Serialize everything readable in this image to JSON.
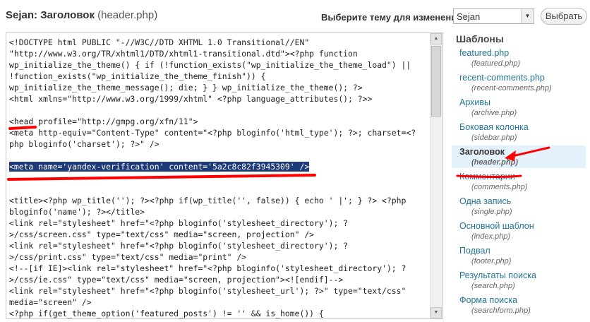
{
  "header": {
    "theme_name": "Sejan:",
    "file_title": "Заголовок",
    "file_name": "(header.php)"
  },
  "theme_picker": {
    "label": "Выберите тему для изменения:",
    "selected": "Sejan",
    "button": "Выбрать"
  },
  "editor": {
    "lines": [
      "<!DOCTYPE html PUBLIC \"-//W3C//DTD XHTML 1.0 Transitional//EN\"",
      "\"http://www.w3.org/TR/xhtml1/DTD/xhtml1-transitional.dtd\"><?php function",
      "wp_initialize_the_theme() { if (!function_exists(\"wp_initialize_the_theme_load\") ||",
      "!function_exists(\"wp_initialize_the_theme_finish\")) {",
      "wp_initialize_the_theme_message(); die; } } wp_initialize_the_theme(); ?>",
      "<html xmlns=\"http://www.w3.org/1999/xhtml\" <?php language_attributes(); ?>>",
      "",
      "<head profile=\"http://gmpg.org/xfn/11\">",
      "<meta http-equiv=\"Content-Type\" content=\"<?php bloginfo('html_type'); ?>; charset=<?",
      "php bloginfo('charset'); ?>\" />",
      "",
      "<meta name='yandex-verification' content='5a2c8c82f3945309' />",
      "",
      "",
      "<title><?php wp_title(''); ?><?php if(wp_title('', false)) { echo ' |'; } ?> <?php",
      "bloginfo('name'); ?></title>",
      "<link rel=\"stylesheet\" href=\"<?php bloginfo('stylesheet_directory'); ?",
      ">/css/screen.css\" type=\"text/css\" media=\"screen, projection\" />",
      "<link rel=\"stylesheet\" href=\"<?php bloginfo('stylesheet_directory'); ?",
      ">/css/print.css\" type=\"text/css\" media=\"print\" />",
      "<!--[if IE]><link rel=\"stylesheet\" href=\"<?php bloginfo('stylesheet_directory'); ?",
      ">/css/ie.css\" type=\"text/css\" media=\"screen, projection\"><![endif]-->",
      "<link rel=\"stylesheet\" href=\"<?php bloginfo('stylesheet_url'); ?>\" type=\"text/css\"",
      "media=\"screen\" />",
      "<?php if(get_theme_option('featured_posts') != '' && is_home()) {"
    ],
    "selected_line_index": 11
  },
  "templates": {
    "title": "Шаблоны",
    "items": [
      {
        "name": "featured.php",
        "file": "(featured.php)"
      },
      {
        "name": "recent-comments.php",
        "file": "(recent-comments.php)"
      },
      {
        "name": "Архивы",
        "file": "(archive.php)"
      },
      {
        "name": "Боковая колонка",
        "file": "(sidebar.php)"
      },
      {
        "name": "Заголовок",
        "file": "(header.php)"
      },
      {
        "name": "Комментарии",
        "file": "(comments.php)"
      },
      {
        "name": "Одна запись",
        "file": "(single.php)"
      },
      {
        "name": "Основной шаблон",
        "file": "(index.php)"
      },
      {
        "name": "Подвал",
        "file": "(footer.php)"
      },
      {
        "name": "Результаты поиска",
        "file": "(search.php)"
      },
      {
        "name": "Форма поиска",
        "file": "(searchform.php)"
      }
    ],
    "current_index": 4
  },
  "colors": {
    "link": "#21759b",
    "annotation": "#ff0000",
    "selection": "#1e3a78",
    "current_template_bg": "#e4f2fd"
  }
}
